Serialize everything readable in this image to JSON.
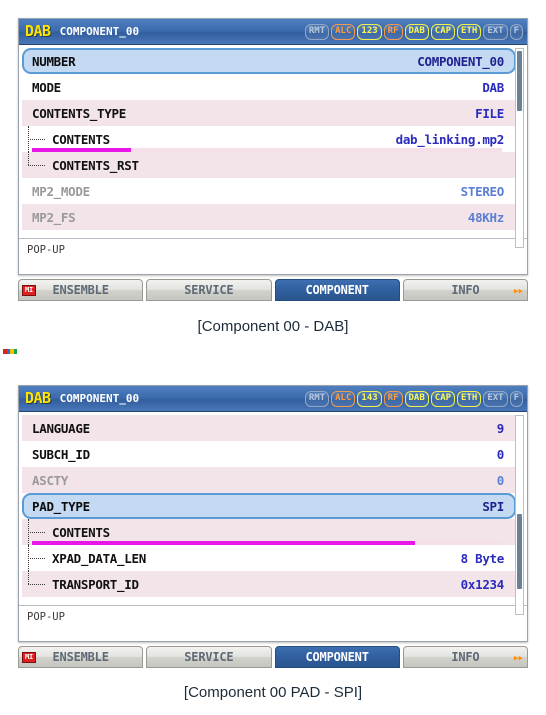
{
  "panels": [
    {
      "id": "component-00-dab",
      "titlebar": {
        "logo": "DAB",
        "title": "COMPONENT_00",
        "badges": [
          {
            "label": "RMT",
            "state": "dim"
          },
          {
            "label": "ALC",
            "state": "orange"
          },
          {
            "label": "123",
            "state": "yellow"
          },
          {
            "label": "RF",
            "state": "orange"
          },
          {
            "label": "DAB",
            "state": "yellow"
          },
          {
            "label": "CAP",
            "state": "yellow"
          },
          {
            "label": "ETH",
            "state": "yellow"
          },
          {
            "label": "EXT",
            "state": "dim"
          },
          {
            "label": "F",
            "state": "dim"
          }
        ]
      },
      "rows": [
        {
          "key": "NUMBER",
          "value": "COMPONENT_00",
          "style": "selected",
          "indent": 0
        },
        {
          "key": "MODE",
          "value": "DAB",
          "style": "white",
          "indent": 0
        },
        {
          "key": "CONTENTS_TYPE",
          "value": "FILE",
          "style": "pink",
          "indent": 0
        },
        {
          "key": "CONTENTS",
          "value": "dab_linking.mp2",
          "style": "white",
          "indent": 1,
          "underline": true
        },
        {
          "key": "CONTENTS_RST",
          "value": "",
          "style": "pink",
          "indent": 1,
          "last": true
        },
        {
          "key": "MP2_MODE",
          "value": "STEREO",
          "style": "white",
          "indent": 0,
          "dim": true
        },
        {
          "key": "MP2_FS",
          "value": "48KHz",
          "style": "pink",
          "indent": 0,
          "dim": true
        }
      ],
      "status": "POP-UP",
      "tabs": [
        {
          "label": "ENSEMBLE",
          "active": false,
          "badge": "MI"
        },
        {
          "label": "SERVICE",
          "active": false
        },
        {
          "label": "COMPONENT",
          "active": true
        },
        {
          "label": "INFO",
          "active": false,
          "arrows": "▸▸"
        }
      ],
      "caption": "[Component 00 - DAB]"
    },
    {
      "id": "component-00-pad-spi",
      "titlebar": {
        "logo": "DAB",
        "title": "COMPONENT_00",
        "badges": [
          {
            "label": "RMT",
            "state": "dim"
          },
          {
            "label": "ALC",
            "state": "orange"
          },
          {
            "label": "143",
            "state": "yellow"
          },
          {
            "label": "RF",
            "state": "orange"
          },
          {
            "label": "DAB",
            "state": "yellow"
          },
          {
            "label": "CAP",
            "state": "yellow"
          },
          {
            "label": "ETH",
            "state": "yellow"
          },
          {
            "label": "EXT",
            "state": "dim"
          },
          {
            "label": "F",
            "state": "dim"
          }
        ]
      },
      "rows": [
        {
          "key": "LANGUAGE",
          "value": "9",
          "style": "pink",
          "indent": 0
        },
        {
          "key": "SUBCH_ID",
          "value": "0",
          "style": "white",
          "indent": 0
        },
        {
          "key": "ASCTY",
          "value": "0",
          "style": "pink",
          "indent": 0,
          "dim": true
        },
        {
          "key": "PAD_TYPE",
          "value": "SPI",
          "style": "selected",
          "indent": 0
        },
        {
          "key": "CONTENTS",
          "value": "",
          "style": "pink",
          "indent": 1,
          "underline": true
        },
        {
          "key": "XPAD_DATA_LEN",
          "value": "8 Byte",
          "style": "white",
          "indent": 1
        },
        {
          "key": "TRANSPORT_ID",
          "value": "0x1234",
          "style": "pink",
          "indent": 1,
          "last": true
        }
      ],
      "status": "POP-UP",
      "tabs": [
        {
          "label": "ENSEMBLE",
          "active": false,
          "badge": "MI"
        },
        {
          "label": "SERVICE",
          "active": false
        },
        {
          "label": "COMPONENT",
          "active": true
        },
        {
          "label": "INFO",
          "active": false,
          "arrows": "▸▸"
        }
      ],
      "caption": "[Component 00 PAD - SPI]"
    }
  ],
  "colors": {
    "titlebar_blue": "#3d6cae",
    "logo_yellow": "#ffe400",
    "row_pink": "#f2e4e8",
    "row_white": "#ffffff",
    "value_blue": "#2b2bbe",
    "selection_fill": "#c3daf2",
    "selection_border": "#5b9bd5",
    "magenta": "#e915e9",
    "active_tab": "#305f9f",
    "badge_red": "#e02020",
    "arrow_orange": "#ff8a00"
  }
}
